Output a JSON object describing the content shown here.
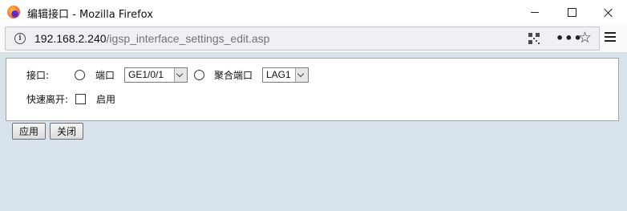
{
  "window": {
    "title": "编辑接口 - Mozilla Firefox",
    "controls": [
      "minimize-icon",
      "maximize-icon",
      "close-icon"
    ]
  },
  "urlbar": {
    "host": "192.168.2.240",
    "path": "/igsp_interface_settings_edit.asp",
    "icons": [
      "info-icon",
      "qr-code-icon",
      "more-icon",
      "bookmark-star-icon",
      "menu-icon"
    ],
    "more_glyph": "•••",
    "star_glyph": "☆"
  },
  "form": {
    "interface_label": "接口:",
    "port_option_label": "端口",
    "port_select_value": "GE1/0/1",
    "lag_option_label": "聚合端口",
    "lag_select_value": "LAG1",
    "fast_leave_label": "快速离开:",
    "fast_leave_checkbox_label": "启用"
  },
  "buttons": {
    "apply": "应用",
    "close": "关闭"
  },
  "colors": {
    "page_background": "#d8e2ea",
    "panel_border": "#9aa8b6"
  }
}
